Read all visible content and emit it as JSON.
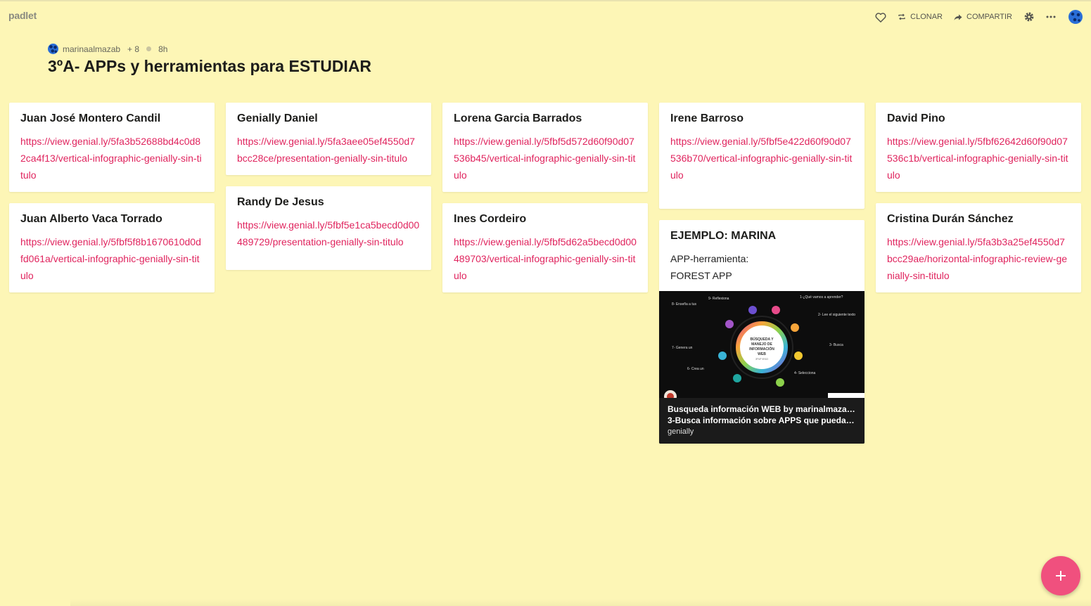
{
  "app": {
    "logo": "padlet"
  },
  "toolbar": {
    "clone_label": "CLONAR",
    "share_label": "COMPARTIR"
  },
  "board": {
    "author": "marinaalmazab",
    "likes": "+ 8",
    "time": "8h",
    "title": "3ºA- APPs y herramientas para ESTUDIAR"
  },
  "columns": [
    {
      "cards": [
        {
          "title": "Juan José Montero Candil",
          "link": "https://view.genial.ly/5fa3b52688bd4c0d82ca4f13/vertical-infographic-genially-sin-titulo"
        },
        {
          "title": "Juan Alberto Vaca Torrado",
          "link": "https://view.genial.ly/5fbf5f8b1670610d0dfd061a/vertical-infographic-genially-sin-titulo"
        }
      ]
    },
    {
      "cards": [
        {
          "title": "Genially Daniel",
          "link": "https://view.genial.ly/5fa3aee05ef4550d7bcc28ce/presentation-genially-sin-titulo"
        },
        {
          "title": "Randy De Jesus",
          "link": "https://view.genial.ly/5fbf5e1ca5becd0d00489729/presentation-genially-sin-titulo"
        }
      ]
    },
    {
      "cards": [
        {
          "title": "Lorena Garcia Barrados",
          "link": "https://view.genial.ly/5fbf5d572d60f90d07536b45/vertical-infographic-genially-sin-titulo"
        },
        {
          "title": "Ines Cordeiro",
          "link": "https://view.genial.ly/5fbf5d62a5becd0d00489703/vertical-infographic-genially-sin-titulo"
        }
      ]
    },
    {
      "cards": [
        {
          "title": "Irene Barroso",
          "link": "https://view.genial.ly/5fbf5e422d60f90d07536b70/vertical-infographic-genially-sin-titulo"
        },
        {
          "title": "EJEMPLO: MARINA",
          "body_line1": "APP-herramienta:",
          "body_line2": "FOREST APP",
          "attachment": {
            "title": "Busqueda información WEB by marinalmaza on...",
            "description": "3-Busca información sobre APPS que puedan a...",
            "source": "genially",
            "image_center_text": "BÚSQUEDA Y MANEJO DE INFORMACIÓN WEB",
            "image_center_sub": "3º/4º ESO",
            "image_steps": [
              "1-¿Qué vamos a aprender?",
              "2- Lee el siguiente texto",
              "3- Busca información sobre APPS que puedan ayudarte en el estudio",
              "4- Selecciona una de esas APPS e investiga sobre ella en",
              "5- Reinténtalo en Genially",
              "6- Crea un Genially con información sobre la APP seleccionada",
              "7- Genera un enlace directo a tu Genially",
              "8- Enseña a tus compañeros tu Genially y cuéntales detalles de la APP escogida",
              "9- Reflexiona"
            ]
          }
        }
      ]
    },
    {
      "cards": [
        {
          "title": "David Pino",
          "link": "https://view.genial.ly/5fbf62642d60f90d07536c1b/vertical-infographic-genially-sin-titulo"
        },
        {
          "title": "Cristina Durán Sánchez",
          "link": "https://view.genial.ly/5fa3b3a25ef4550d7bcc29ae/horizontal-infographic-review-genially-sin-titulo"
        }
      ]
    }
  ],
  "colors": {
    "background": "#fdf6b6",
    "link": "#e0245e",
    "fab": "#f0507e"
  }
}
